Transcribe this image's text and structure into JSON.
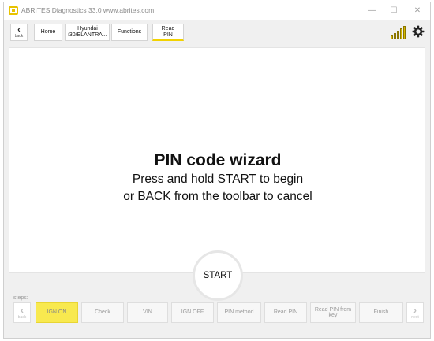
{
  "window": {
    "title": "ABRITES Diagnostics 33.0   www.abrites.com",
    "minimize": "—",
    "maximize": "☐",
    "close": "✕"
  },
  "toolbar": {
    "back_label": "back",
    "home_label": "Home",
    "vehicle_label": "Hyundai\ni30/ELANTRA...",
    "functions_label": "Functions",
    "read_pin_label": "Read\nPIN"
  },
  "wizard": {
    "title": "PIN code wizard",
    "line1": "Press and hold START to begin",
    "line2": "or BACK from the toolbar to cancel",
    "start_label": "START"
  },
  "steps": {
    "label": "steps:",
    "back_label": "back",
    "next_label": "next",
    "items": [
      {
        "label": "IGN ON"
      },
      {
        "label": "Check"
      },
      {
        "label": "VIN"
      },
      {
        "label": "IGN OFF"
      },
      {
        "label": "PIN method"
      },
      {
        "label": "Read PIN"
      },
      {
        "label": "Read PIN from\nkey"
      },
      {
        "label": "Finish"
      }
    ],
    "current_index": 0
  },
  "colors": {
    "accent": "#f8e94f",
    "logo": "#e8c300",
    "signal": "#d6b800"
  },
  "icons": {
    "app": "abrites-logo-icon",
    "signal": "signal-strength-icon",
    "settings": "gear-icon",
    "back": "chevron-left-icon",
    "next": "chevron-right-icon"
  }
}
